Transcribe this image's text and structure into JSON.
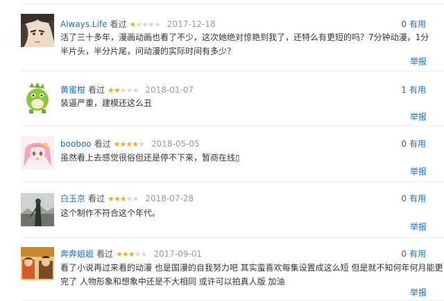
{
  "ui": {
    "useful_label": "有用",
    "report_label": "举报",
    "watched_label": "看过"
  },
  "reviews": [
    {
      "username": "Always.Life",
      "stars": "★",
      "stars_off": "★★★★",
      "rating": 1,
      "date": "2017-12-18",
      "useful_count": "0",
      "content": "活了三十多年，漫画动画也看了不少，这次她绝对惊艳到我了，还特么有更短的吗？7分钟动漫，1分半片头，半分片尾，问动漫的实际时间有多少？"
    },
    {
      "username": "黄蜜柑",
      "stars": "★★",
      "stars_off": "★★★",
      "rating": 2,
      "date": "2018-01-07",
      "useful_count": "1",
      "content": "装逼严重，建模还这么丑"
    },
    {
      "username": "booboo",
      "stars": "★★★★",
      "stars_off": "★",
      "rating": 4,
      "date": "2018-05-05",
      "useful_count": "0",
      "content": "虽然看上去感觉很俗但还是停不下来，暂商在线▯"
    },
    {
      "username": "白玉京",
      "stars": "★★★",
      "stars_off": "★★",
      "rating": 3,
      "date": "2018-07-28",
      "useful_count": "0",
      "content": "这个制作不符合这个年代。"
    },
    {
      "username": "奔奔姐姐",
      "stars": "★★★",
      "stars_off": "★★",
      "rating": 3,
      "date": "2017-09-01",
      "useful_count": "0",
      "content": "看了小说再过来看的动漫 也是国漫的自我努力吧 其实蛮喜欢每集设置成这么短 但是就不知何年何月能更完了 人物形象和想象中还是不大相同 或许可以拍真人版 加油"
    }
  ]
}
